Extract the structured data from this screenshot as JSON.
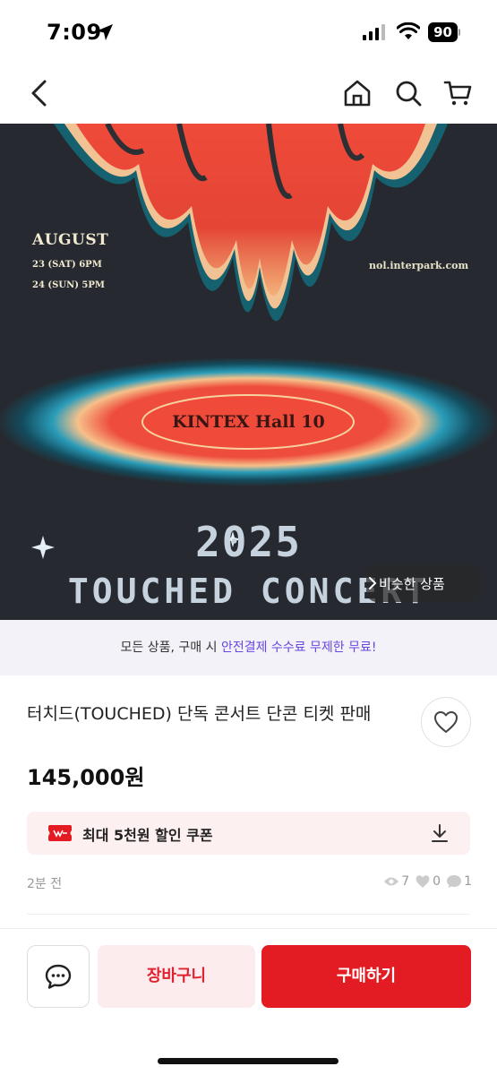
{
  "status_bar": {
    "time": "7:09",
    "battery": "90",
    "icons": [
      "location-arrow-icon",
      "signal-icon",
      "wifi-icon",
      "battery-icon"
    ]
  },
  "nav": {
    "icons": [
      "back-icon",
      "home-icon",
      "search-icon",
      "cart-icon"
    ]
  },
  "poster": {
    "month": "AUGUST",
    "date1": "23 (SAT) 6PM",
    "date2": "24 (SUN) 5PM",
    "url": "nol.interpark.com",
    "venue": "KINTEX Hall 10",
    "year": "2025",
    "title": "TOUCHED CONCERT"
  },
  "similar_button": {
    "label": "비슷한 상품"
  },
  "safe_banner": {
    "prefix": "모든 상품, 구매 시 ",
    "highlight": "안전결제 수수료 무제한 무료!"
  },
  "product": {
    "title": "터치드(TOUCHED) 단독 콘서트 단콘 티켓 판매",
    "price": "145,000원"
  },
  "coupon": {
    "label": "최대 5천원 할인 쿠폰"
  },
  "meta": {
    "time_ago": "2분 전",
    "views": "7",
    "likes": "0",
    "chats": "1"
  },
  "bottom": {
    "cart_label": "장바구니",
    "buy_label": "구매하기"
  },
  "colors": {
    "accent": "#e31b23",
    "banner_highlight": "#6a45e0",
    "poster_bg": "#262a30"
  }
}
